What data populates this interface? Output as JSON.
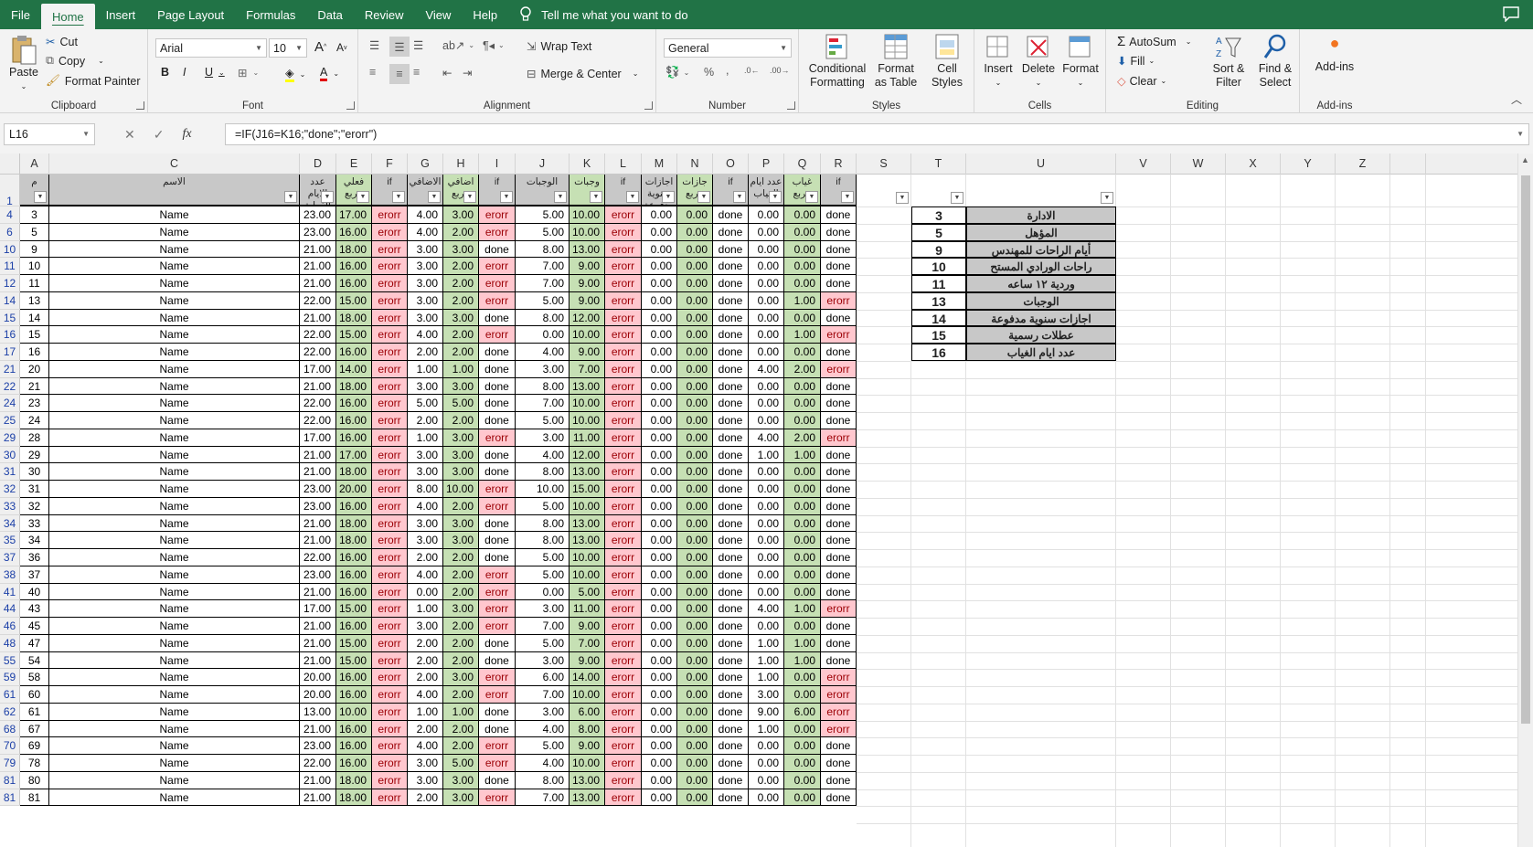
{
  "tabs": [
    "File",
    "Home",
    "Insert",
    "Page Layout",
    "Formulas",
    "Data",
    "Review",
    "View",
    "Help"
  ],
  "active_tab": "Home",
  "tell_me": "Tell me what you want to do",
  "ribbon": {
    "clipboard": {
      "paste": "Paste",
      "cut": "Cut",
      "copy": "Copy",
      "format_painter": "Format Painter",
      "label": "Clipboard"
    },
    "font": {
      "name": "Arial",
      "size": "10",
      "label": "Font"
    },
    "alignment": {
      "wrap_text": "Wrap Text",
      "merge_center": "Merge & Center",
      "label": "Alignment"
    },
    "number": {
      "format": "General",
      "label": "Number"
    },
    "styles": {
      "conditional": "Conditional Formatting",
      "format_table": "Format as Table",
      "cell_styles": "Cell Styles",
      "label": "Styles"
    },
    "cells": {
      "insert": "Insert",
      "delete": "Delete",
      "format": "Format",
      "label": "Cells"
    },
    "editing": {
      "autosum": "AutoSum",
      "fill": "Fill",
      "clear": "Clear",
      "sort": "Sort & Filter",
      "find": "Find & Select",
      "label": "Editing"
    },
    "addins": {
      "addins": "Add-ins",
      "label": "Add-ins"
    }
  },
  "name_box": "L16",
  "formula": "=IF(J16=K16;\"done\";\"erorr\")",
  "columns": [
    "A",
    "C",
    "D",
    "E",
    "F",
    "G",
    "H",
    "I",
    "J",
    "K",
    "L",
    "M",
    "N",
    "O",
    "P",
    "Q",
    "R",
    "S",
    "T",
    "U",
    "V",
    "W",
    "X",
    "Y",
    "Z"
  ],
  "headers": {
    "A": "م",
    "C": "الاسم",
    "D": "عدد الايام الفعلية",
    "E": "فعلي مربع",
    "F": "if",
    "G": "الاضافي",
    "H": "اضافي مربع",
    "I": "if",
    "J": "الوجبات",
    "K": "وجبات",
    "L": "if",
    "M": "اجازات سنوية مدفوعة",
    "N": "جازات مربع",
    "O": "if",
    "P": "عدد ايام الغياب",
    "Q": "غياب مربع",
    "R": "if"
  },
  "rows": [
    {
      "r": "4",
      "A": "3",
      "C": "Name",
      "D": "23.00",
      "E": "17.00",
      "F": "erorr",
      "G": "4.00",
      "H": "3.00",
      "I": "erorr",
      "J": "5.00",
      "K": "10.00",
      "L": "erorr",
      "M": "0.00",
      "N": "0.00",
      "O": "done",
      "P": "0.00",
      "Q": "0.00",
      "R": "done"
    },
    {
      "r": "6",
      "A": "5",
      "C": "Name",
      "D": "23.00",
      "E": "16.00",
      "F": "erorr",
      "G": "4.00",
      "H": "2.00",
      "I": "erorr",
      "J": "5.00",
      "K": "10.00",
      "L": "erorr",
      "M": "0.00",
      "N": "0.00",
      "O": "done",
      "P": "0.00",
      "Q": "0.00",
      "R": "done"
    },
    {
      "r": "10",
      "A": "9",
      "C": "Name",
      "D": "21.00",
      "E": "18.00",
      "F": "erorr",
      "G": "3.00",
      "H": "3.00",
      "I": "done",
      "J": "8.00",
      "K": "13.00",
      "L": "erorr",
      "M": "0.00",
      "N": "0.00",
      "O": "done",
      "P": "0.00",
      "Q": "0.00",
      "R": "done"
    },
    {
      "r": "11",
      "A": "10",
      "C": "Name",
      "D": "21.00",
      "E": "16.00",
      "F": "erorr",
      "G": "3.00",
      "H": "2.00",
      "I": "erorr",
      "J": "7.00",
      "K": "9.00",
      "L": "erorr",
      "M": "0.00",
      "N": "0.00",
      "O": "done",
      "P": "0.00",
      "Q": "0.00",
      "R": "done"
    },
    {
      "r": "12",
      "A": "11",
      "C": "Name",
      "D": "21.00",
      "E": "16.00",
      "F": "erorr",
      "G": "3.00",
      "H": "2.00",
      "I": "erorr",
      "J": "7.00",
      "K": "9.00",
      "L": "erorr",
      "M": "0.00",
      "N": "0.00",
      "O": "done",
      "P": "0.00",
      "Q": "0.00",
      "R": "done"
    },
    {
      "r": "14",
      "A": "13",
      "C": "Name",
      "D": "22.00",
      "E": "15.00",
      "F": "erorr",
      "G": "3.00",
      "H": "2.00",
      "I": "erorr",
      "J": "5.00",
      "K": "9.00",
      "L": "erorr",
      "M": "0.00",
      "N": "0.00",
      "O": "done",
      "P": "0.00",
      "Q": "1.00",
      "R": "erorr"
    },
    {
      "r": "15",
      "A": "14",
      "C": "Name",
      "D": "21.00",
      "E": "18.00",
      "F": "erorr",
      "G": "3.00",
      "H": "3.00",
      "I": "done",
      "J": "8.00",
      "K": "12.00",
      "L": "erorr",
      "M": "0.00",
      "N": "0.00",
      "O": "done",
      "P": "0.00",
      "Q": "0.00",
      "R": "done"
    },
    {
      "r": "16",
      "A": "15",
      "C": "Name",
      "D": "22.00",
      "E": "15.00",
      "F": "erorr",
      "G": "4.00",
      "H": "2.00",
      "I": "erorr",
      "J": "0.00",
      "K": "10.00",
      "L": "erorr",
      "M": "0.00",
      "N": "0.00",
      "O": "done",
      "P": "0.00",
      "Q": "1.00",
      "R": "erorr"
    },
    {
      "r": "17",
      "A": "16",
      "C": "Name",
      "D": "22.00",
      "E": "16.00",
      "F": "erorr",
      "G": "2.00",
      "H": "2.00",
      "I": "done",
      "J": "4.00",
      "K": "9.00",
      "L": "erorr",
      "M": "0.00",
      "N": "0.00",
      "O": "done",
      "P": "0.00",
      "Q": "0.00",
      "R": "done"
    },
    {
      "r": "21",
      "A": "20",
      "C": "Name",
      "D": "17.00",
      "E": "14.00",
      "F": "erorr",
      "G": "1.00",
      "H": "1.00",
      "I": "done",
      "J": "3.00",
      "K": "7.00",
      "L": "erorr",
      "M": "0.00",
      "N": "0.00",
      "O": "done",
      "P": "4.00",
      "Q": "2.00",
      "R": "erorr"
    },
    {
      "r": "22",
      "A": "21",
      "C": "Name",
      "D": "21.00",
      "E": "18.00",
      "F": "erorr",
      "G": "3.00",
      "H": "3.00",
      "I": "done",
      "J": "8.00",
      "K": "13.00",
      "L": "erorr",
      "M": "0.00",
      "N": "0.00",
      "O": "done",
      "P": "0.00",
      "Q": "0.00",
      "R": "done"
    },
    {
      "r": "24",
      "A": "23",
      "C": "Name",
      "D": "22.00",
      "E": "16.00",
      "F": "erorr",
      "G": "5.00",
      "H": "5.00",
      "I": "done",
      "J": "7.00",
      "K": "10.00",
      "L": "erorr",
      "M": "0.00",
      "N": "0.00",
      "O": "done",
      "P": "0.00",
      "Q": "0.00",
      "R": "done"
    },
    {
      "r": "25",
      "A": "24",
      "C": "Name",
      "D": "22.00",
      "E": "16.00",
      "F": "erorr",
      "G": "2.00",
      "H": "2.00",
      "I": "done",
      "J": "5.00",
      "K": "10.00",
      "L": "erorr",
      "M": "0.00",
      "N": "0.00",
      "O": "done",
      "P": "0.00",
      "Q": "0.00",
      "R": "done"
    },
    {
      "r": "29",
      "A": "28",
      "C": "Name",
      "D": "17.00",
      "E": "16.00",
      "F": "erorr",
      "G": "1.00",
      "H": "3.00",
      "I": "erorr",
      "J": "3.00",
      "K": "11.00",
      "L": "erorr",
      "M": "0.00",
      "N": "0.00",
      "O": "done",
      "P": "4.00",
      "Q": "2.00",
      "R": "erorr"
    },
    {
      "r": "30",
      "A": "29",
      "C": "Name",
      "D": "21.00",
      "E": "17.00",
      "F": "erorr",
      "G": "3.00",
      "H": "3.00",
      "I": "done",
      "J": "4.00",
      "K": "12.00",
      "L": "erorr",
      "M": "0.00",
      "N": "0.00",
      "O": "done",
      "P": "1.00",
      "Q": "1.00",
      "R": "done"
    },
    {
      "r": "31",
      "A": "30",
      "C": "Name",
      "D": "21.00",
      "E": "18.00",
      "F": "erorr",
      "G": "3.00",
      "H": "3.00",
      "I": "done",
      "J": "8.00",
      "K": "13.00",
      "L": "erorr",
      "M": "0.00",
      "N": "0.00",
      "O": "done",
      "P": "0.00",
      "Q": "0.00",
      "R": "done"
    },
    {
      "r": "32",
      "A": "31",
      "C": "Name",
      "D": "23.00",
      "E": "20.00",
      "F": "erorr",
      "G": "8.00",
      "H": "10.00",
      "I": "erorr",
      "J": "10.00",
      "K": "15.00",
      "L": "erorr",
      "M": "0.00",
      "N": "0.00",
      "O": "done",
      "P": "0.00",
      "Q": "0.00",
      "R": "done"
    },
    {
      "r": "33",
      "A": "32",
      "C": "Name",
      "D": "23.00",
      "E": "16.00",
      "F": "erorr",
      "G": "4.00",
      "H": "2.00",
      "I": "erorr",
      "J": "5.00",
      "K": "10.00",
      "L": "erorr",
      "M": "0.00",
      "N": "0.00",
      "O": "done",
      "P": "0.00",
      "Q": "0.00",
      "R": "done"
    },
    {
      "r": "34",
      "A": "33",
      "C": "Name",
      "D": "21.00",
      "E": "18.00",
      "F": "erorr",
      "G": "3.00",
      "H": "3.00",
      "I": "done",
      "J": "8.00",
      "K": "13.00",
      "L": "erorr",
      "M": "0.00",
      "N": "0.00",
      "O": "done",
      "P": "0.00",
      "Q": "0.00",
      "R": "done"
    },
    {
      "r": "35",
      "A": "34",
      "C": "Name",
      "D": "21.00",
      "E": "18.00",
      "F": "erorr",
      "G": "3.00",
      "H": "3.00",
      "I": "done",
      "J": "8.00",
      "K": "13.00",
      "L": "erorr",
      "M": "0.00",
      "N": "0.00",
      "O": "done",
      "P": "0.00",
      "Q": "0.00",
      "R": "done"
    },
    {
      "r": "37",
      "A": "36",
      "C": "Name",
      "D": "22.00",
      "E": "16.00",
      "F": "erorr",
      "G": "2.00",
      "H": "2.00",
      "I": "done",
      "J": "5.00",
      "K": "10.00",
      "L": "erorr",
      "M": "0.00",
      "N": "0.00",
      "O": "done",
      "P": "0.00",
      "Q": "0.00",
      "R": "done"
    },
    {
      "r": "38",
      "A": "37",
      "C": "Name",
      "D": "23.00",
      "E": "16.00",
      "F": "erorr",
      "G": "4.00",
      "H": "2.00",
      "I": "erorr",
      "J": "5.00",
      "K": "10.00",
      "L": "erorr",
      "M": "0.00",
      "N": "0.00",
      "O": "done",
      "P": "0.00",
      "Q": "0.00",
      "R": "done"
    },
    {
      "r": "41",
      "A": "40",
      "C": "Name",
      "D": "21.00",
      "E": "16.00",
      "F": "erorr",
      "G": "0.00",
      "H": "2.00",
      "I": "erorr",
      "J": "0.00",
      "K": "5.00",
      "L": "erorr",
      "M": "0.00",
      "N": "0.00",
      "O": "done",
      "P": "0.00",
      "Q": "0.00",
      "R": "done"
    },
    {
      "r": "44",
      "A": "43",
      "C": "Name",
      "D": "17.00",
      "E": "15.00",
      "F": "erorr",
      "G": "1.00",
      "H": "3.00",
      "I": "erorr",
      "J": "3.00",
      "K": "11.00",
      "L": "erorr",
      "M": "0.00",
      "N": "0.00",
      "O": "done",
      "P": "4.00",
      "Q": "1.00",
      "R": "erorr"
    },
    {
      "r": "46",
      "A": "45",
      "C": "Name",
      "D": "21.00",
      "E": "16.00",
      "F": "erorr",
      "G": "3.00",
      "H": "2.00",
      "I": "erorr",
      "J": "7.00",
      "K": "9.00",
      "L": "erorr",
      "M": "0.00",
      "N": "0.00",
      "O": "done",
      "P": "0.00",
      "Q": "0.00",
      "R": "done"
    },
    {
      "r": "48",
      "A": "47",
      "C": "Name",
      "D": "21.00",
      "E": "15.00",
      "F": "erorr",
      "G": "2.00",
      "H": "2.00",
      "I": "done",
      "J": "5.00",
      "K": "7.00",
      "L": "erorr",
      "M": "0.00",
      "N": "0.00",
      "O": "done",
      "P": "1.00",
      "Q": "1.00",
      "R": "done"
    },
    {
      "r": "55",
      "A": "54",
      "C": "Name",
      "D": "21.00",
      "E": "15.00",
      "F": "erorr",
      "G": "2.00",
      "H": "2.00",
      "I": "done",
      "J": "3.00",
      "K": "9.00",
      "L": "erorr",
      "M": "0.00",
      "N": "0.00",
      "O": "done",
      "P": "1.00",
      "Q": "1.00",
      "R": "done"
    },
    {
      "r": "59",
      "A": "58",
      "C": "Name",
      "D": "20.00",
      "E": "16.00",
      "F": "erorr",
      "G": "2.00",
      "H": "3.00",
      "I": "erorr",
      "J": "6.00",
      "K": "14.00",
      "L": "erorr",
      "M": "0.00",
      "N": "0.00",
      "O": "done",
      "P": "1.00",
      "Q": "0.00",
      "R": "erorr"
    },
    {
      "r": "61",
      "A": "60",
      "C": "Name",
      "D": "20.00",
      "E": "16.00",
      "F": "erorr",
      "G": "4.00",
      "H": "2.00",
      "I": "erorr",
      "J": "7.00",
      "K": "10.00",
      "L": "erorr",
      "M": "0.00",
      "N": "0.00",
      "O": "done",
      "P": "3.00",
      "Q": "0.00",
      "R": "erorr"
    },
    {
      "r": "62",
      "A": "61",
      "C": "Name",
      "D": "13.00",
      "E": "10.00",
      "F": "erorr",
      "G": "1.00",
      "H": "1.00",
      "I": "done",
      "J": "3.00",
      "K": "6.00",
      "L": "erorr",
      "M": "0.00",
      "N": "0.00",
      "O": "done",
      "P": "9.00",
      "Q": "6.00",
      "R": "erorr"
    },
    {
      "r": "68",
      "A": "67",
      "C": "Name",
      "D": "21.00",
      "E": "16.00",
      "F": "erorr",
      "G": "2.00",
      "H": "2.00",
      "I": "done",
      "J": "4.00",
      "K": "8.00",
      "L": "erorr",
      "M": "0.00",
      "N": "0.00",
      "O": "done",
      "P": "1.00",
      "Q": "0.00",
      "R": "erorr"
    },
    {
      "r": "70",
      "A": "69",
      "C": "Name",
      "D": "23.00",
      "E": "16.00",
      "F": "erorr",
      "G": "4.00",
      "H": "2.00",
      "I": "erorr",
      "J": "5.00",
      "K": "9.00",
      "L": "erorr",
      "M": "0.00",
      "N": "0.00",
      "O": "done",
      "P": "0.00",
      "Q": "0.00",
      "R": "done"
    },
    {
      "r": "79",
      "A": "78",
      "C": "Name",
      "D": "22.00",
      "E": "16.00",
      "F": "erorr",
      "G": "3.00",
      "H": "5.00",
      "I": "erorr",
      "J": "4.00",
      "K": "10.00",
      "L": "erorr",
      "M": "0.00",
      "N": "0.00",
      "O": "done",
      "P": "0.00",
      "Q": "0.00",
      "R": "done"
    },
    {
      "r": "81",
      "A": "80",
      "C": "Name",
      "D": "21.00",
      "E": "18.00",
      "F": "erorr",
      "G": "3.00",
      "H": "3.00",
      "I": "done",
      "J": "8.00",
      "K": "13.00",
      "L": "erorr",
      "M": "0.00",
      "N": "0.00",
      "O": "done",
      "P": "0.00",
      "Q": "0.00",
      "R": "done"
    },
    {
      "r": "81",
      "A": "81",
      "C": "Name",
      "D": "21.00",
      "E": "18.00",
      "F": "erorr",
      "G": "2.00",
      "H": "3.00",
      "I": "erorr",
      "J": "7.00",
      "K": "13.00",
      "L": "erorr",
      "M": "0.00",
      "N": "0.00",
      "O": "done",
      "P": "0.00",
      "Q": "0.00",
      "R": "done"
    }
  ],
  "lookup": [
    {
      "num": "3",
      "label": "الادارة"
    },
    {
      "num": "5",
      "label": "المؤهل"
    },
    {
      "num": "9",
      "label": "أيام الراحات للمهندس"
    },
    {
      "num": "10",
      "label": "راحات الورادي المستح"
    },
    {
      "num": "11",
      "label": "وردية ١٢ ساعه"
    },
    {
      "num": "13",
      "label": "الوجبات"
    },
    {
      "num": "14",
      "label": "اجازات سنوية مدفوعة"
    },
    {
      "num": "15",
      "label": "عطلات رسمية"
    },
    {
      "num": "16",
      "label": "عدد ايام الغياب"
    }
  ],
  "colors": {
    "green_fill": "#c6e0b4",
    "red_fill": "#ffc7ce",
    "red_text": "#9c0006",
    "header_fill": "#c8c8c8",
    "brand": "#217346"
  }
}
